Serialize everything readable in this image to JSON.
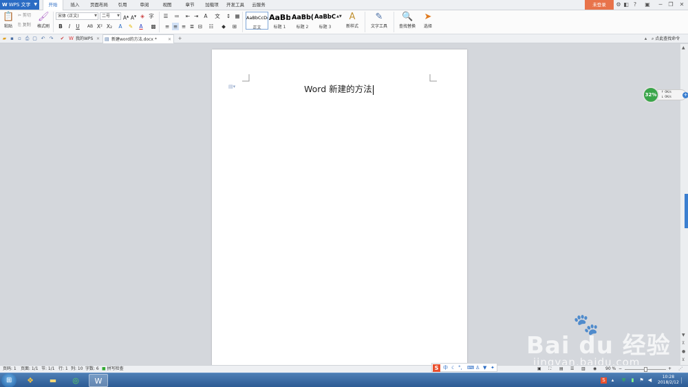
{
  "app": {
    "name": "WPS 文字",
    "login_label": "未登录"
  },
  "menu": {
    "tabs": [
      "开始",
      "插入",
      "页面布局",
      "引用",
      "审阅",
      "视图",
      "章节",
      "加载项",
      "开发工具",
      "云服务"
    ],
    "active_tab": "开始"
  },
  "ribbon": {
    "paste": "粘贴",
    "cut": "剪切",
    "copy": "复制",
    "format_painter": "格式刷",
    "font_name": "宋体 (正文)",
    "font_size": "二号",
    "styles": [
      {
        "sample": "AaBbCcDd",
        "name": "正文"
      },
      {
        "sample": "AaBb",
        "name": "标题 1"
      },
      {
        "sample": "AaBb(",
        "name": "标题 2"
      },
      {
        "sample": "AaBbC",
        "name": "标题 3"
      }
    ],
    "new_style": "新样式",
    "text_tools": "文字工具",
    "find_replace": "查找替换",
    "select": "选择"
  },
  "tabs": {
    "my_wps": "我的WPS",
    "document": "新建word的方法.docx *",
    "search_doc": "点此查找命令"
  },
  "document": {
    "text": "Word 新建的方法"
  },
  "speed_widget": {
    "percent": "32%",
    "up": "0K/s",
    "down": "0K/s"
  },
  "status": {
    "page_num": "页码: 1",
    "pages": "页面: 1/1",
    "section": "节: 1/1",
    "row": "行: 1",
    "col": "列: 10",
    "words": "字数: 6",
    "spell": "拼写检查",
    "zoom": "90 %"
  },
  "watermark": {
    "brand": "Bai du 经验",
    "url": "jingyan.baidu.com"
  },
  "taskbar": {
    "time": "10:28",
    "date": "2018/2/12"
  },
  "colors": {
    "app_blue": "#2b6cc4",
    "login_orange": "#e8734a",
    "speed_green": "#3aa54a"
  }
}
